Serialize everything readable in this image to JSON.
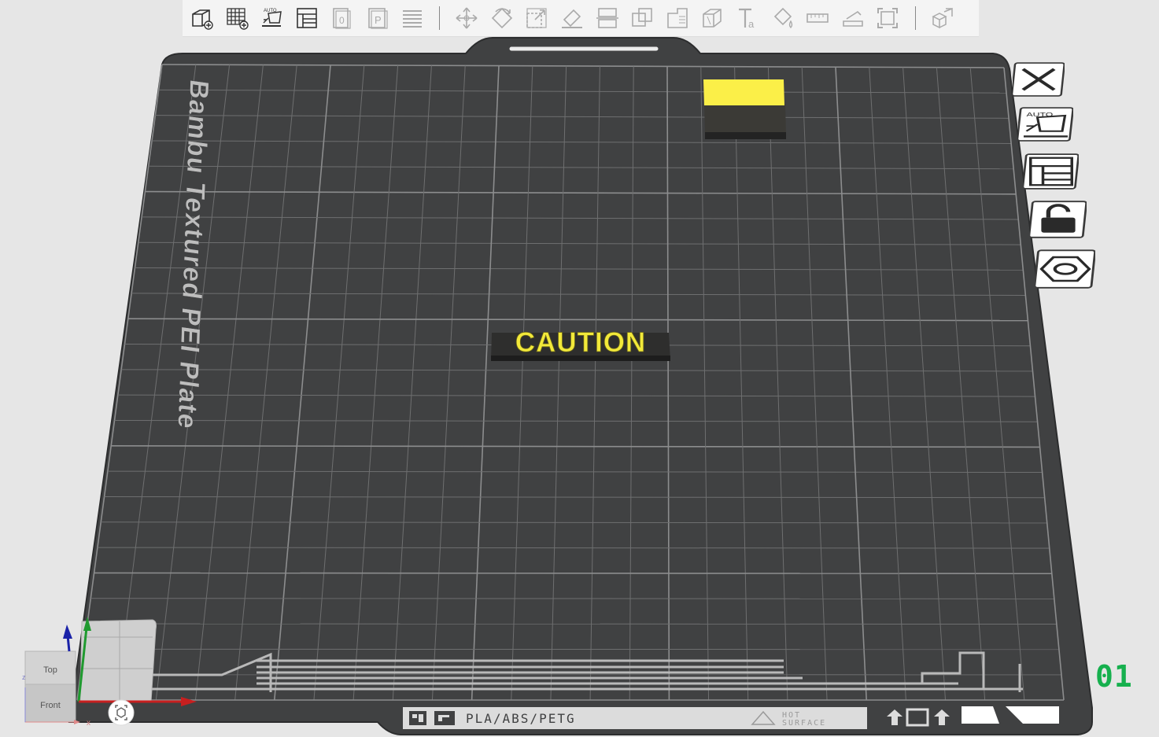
{
  "toolbar": {
    "items": [
      {
        "icon": "add-cube-icon",
        "disabled": false
      },
      {
        "icon": "add-plate-icon",
        "disabled": false
      },
      {
        "icon": "auto-orient-icon",
        "disabled": false
      },
      {
        "icon": "arrange-icon",
        "disabled": false
      },
      {
        "icon": "copy-icon",
        "disabled": true
      },
      {
        "icon": "paste-icon",
        "disabled": true
      },
      {
        "icon": "layers-icon",
        "disabled": true
      },
      {
        "separator": true
      },
      {
        "icon": "move-icon",
        "disabled": true
      },
      {
        "icon": "rotate-icon",
        "disabled": true
      },
      {
        "icon": "scale-icon",
        "disabled": true
      },
      {
        "icon": "lay-on-face-icon",
        "disabled": true
      },
      {
        "icon": "cut-icon",
        "disabled": true
      },
      {
        "icon": "boolean-icon",
        "disabled": true
      },
      {
        "icon": "support-paint-icon",
        "disabled": true
      },
      {
        "icon": "seam-paint-icon",
        "disabled": true
      },
      {
        "icon": "text-icon",
        "disabled": true
      },
      {
        "icon": "color-paint-icon",
        "disabled": true
      },
      {
        "icon": "measure-icon",
        "disabled": true
      },
      {
        "icon": "assembly-icon",
        "disabled": true
      },
      {
        "icon": "fit-view-icon",
        "disabled": true
      },
      {
        "separator": true
      },
      {
        "icon": "explode-icon",
        "disabled": true
      }
    ]
  },
  "plate": {
    "label": "Bambu Textured PEI Plate",
    "number": "01",
    "footer_material": "PLA/ABS/PETG",
    "footer_warning_line1": "HOT",
    "footer_warning_line2": "SURFACE"
  },
  "objects": {
    "caution_text": "CAUTION",
    "caution_color": "#f2e93a",
    "block_top_color": "#fbef48"
  },
  "plate_tools": [
    {
      "icon": "close-plate-icon"
    },
    {
      "icon": "auto-orient-plate-icon"
    },
    {
      "icon": "arrange-plate-icon"
    },
    {
      "icon": "lock-plate-icon"
    },
    {
      "icon": "plate-settings-icon"
    }
  ],
  "navcube": {
    "top_label": "Top",
    "front_label": "Front",
    "axis_x": "x",
    "axis_z": "z"
  },
  "colors": {
    "background": "#e6e6e6",
    "plate": "#404142",
    "grid": "#7a7b7c",
    "accent_green": "#16b04e"
  }
}
